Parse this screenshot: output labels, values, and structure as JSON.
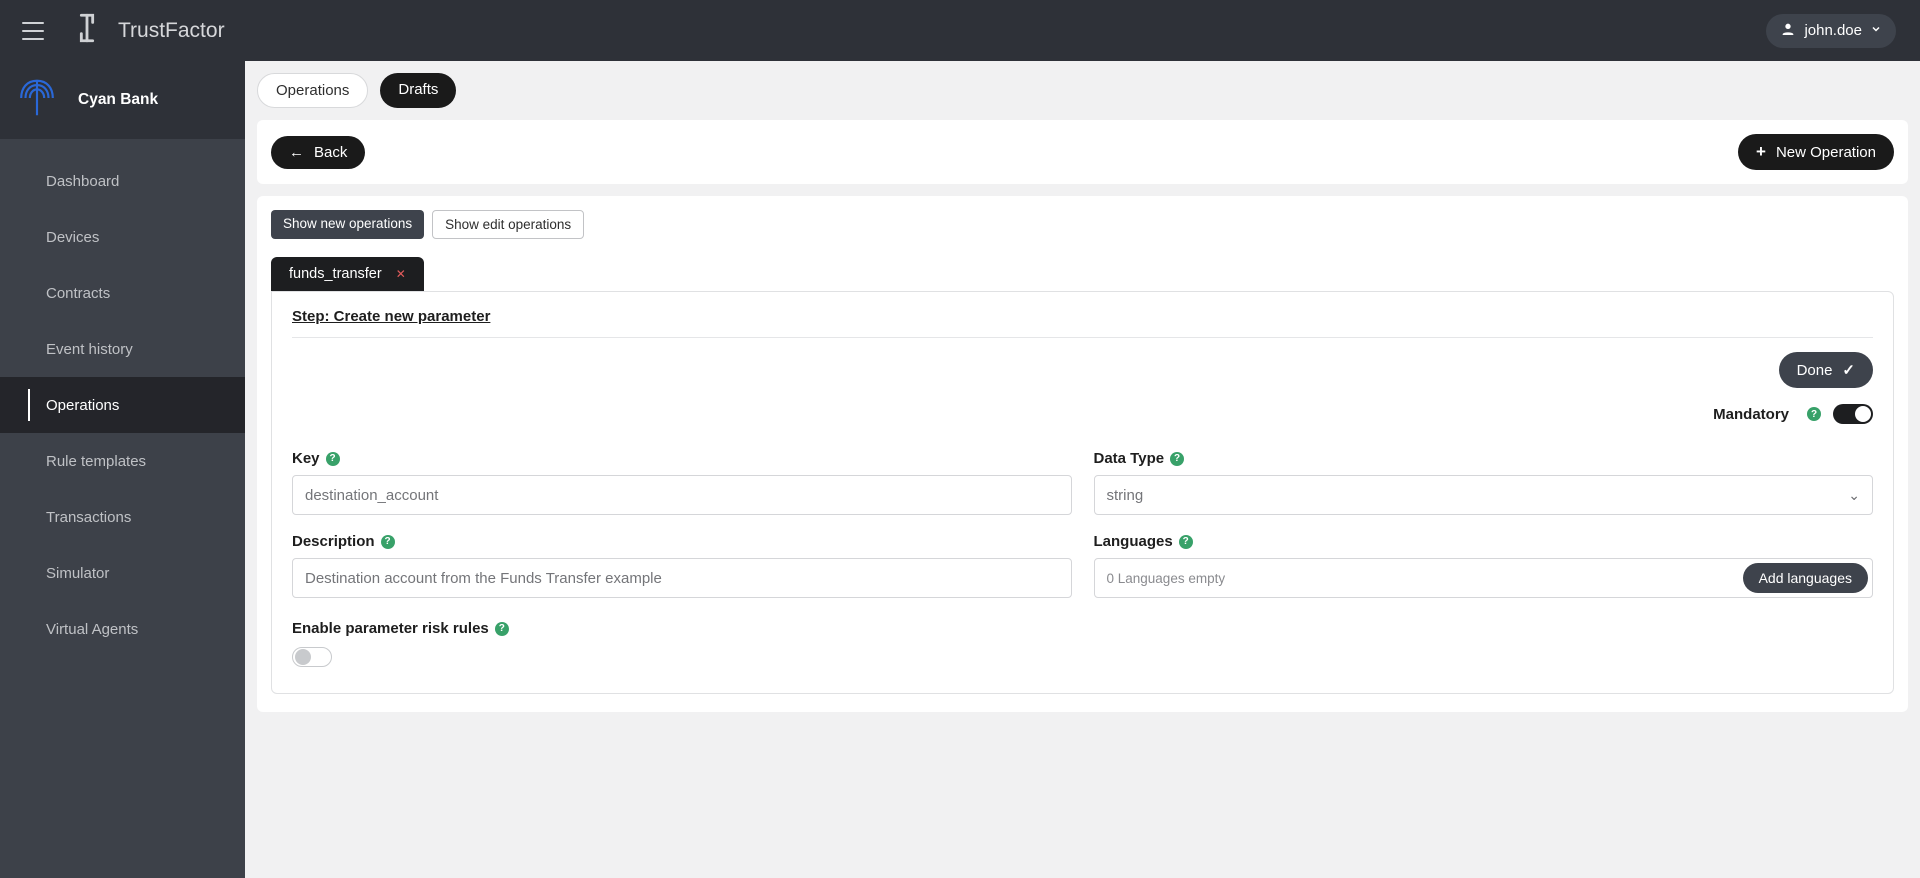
{
  "header": {
    "brand": "TrustFactor",
    "user": "john.doe"
  },
  "tenant": {
    "name": "Cyan Bank"
  },
  "sidebar": {
    "items": [
      {
        "label": "Dashboard",
        "active": false
      },
      {
        "label": "Devices",
        "active": false
      },
      {
        "label": "Contracts",
        "active": false
      },
      {
        "label": "Event history",
        "active": false
      },
      {
        "label": "Operations",
        "active": true
      },
      {
        "label": "Rule templates",
        "active": false
      },
      {
        "label": "Transactions",
        "active": false
      },
      {
        "label": "Simulator",
        "active": false
      },
      {
        "label": "Virtual Agents",
        "active": false
      }
    ]
  },
  "tabs": {
    "operations": "Operations",
    "drafts": "Drafts"
  },
  "actions": {
    "back": "Back",
    "new_operation": "New Operation"
  },
  "filters": {
    "show_new": "Show new operations",
    "show_edit": "Show edit operations"
  },
  "draft_tab": {
    "name": "funds_transfer"
  },
  "panel": {
    "title": "Step: Create new parameter",
    "done": "Done",
    "mandatory_label": "Mandatory",
    "key_label": "Key",
    "key_value": "destination_account",
    "data_type_label": "Data Type",
    "data_type_value": "string",
    "description_label": "Description",
    "description_value": "Destination account from the Funds Transfer example",
    "languages_label": "Languages",
    "languages_status": "0 Languages empty",
    "add_languages": "Add languages",
    "risk_label": "Enable parameter risk rules"
  }
}
